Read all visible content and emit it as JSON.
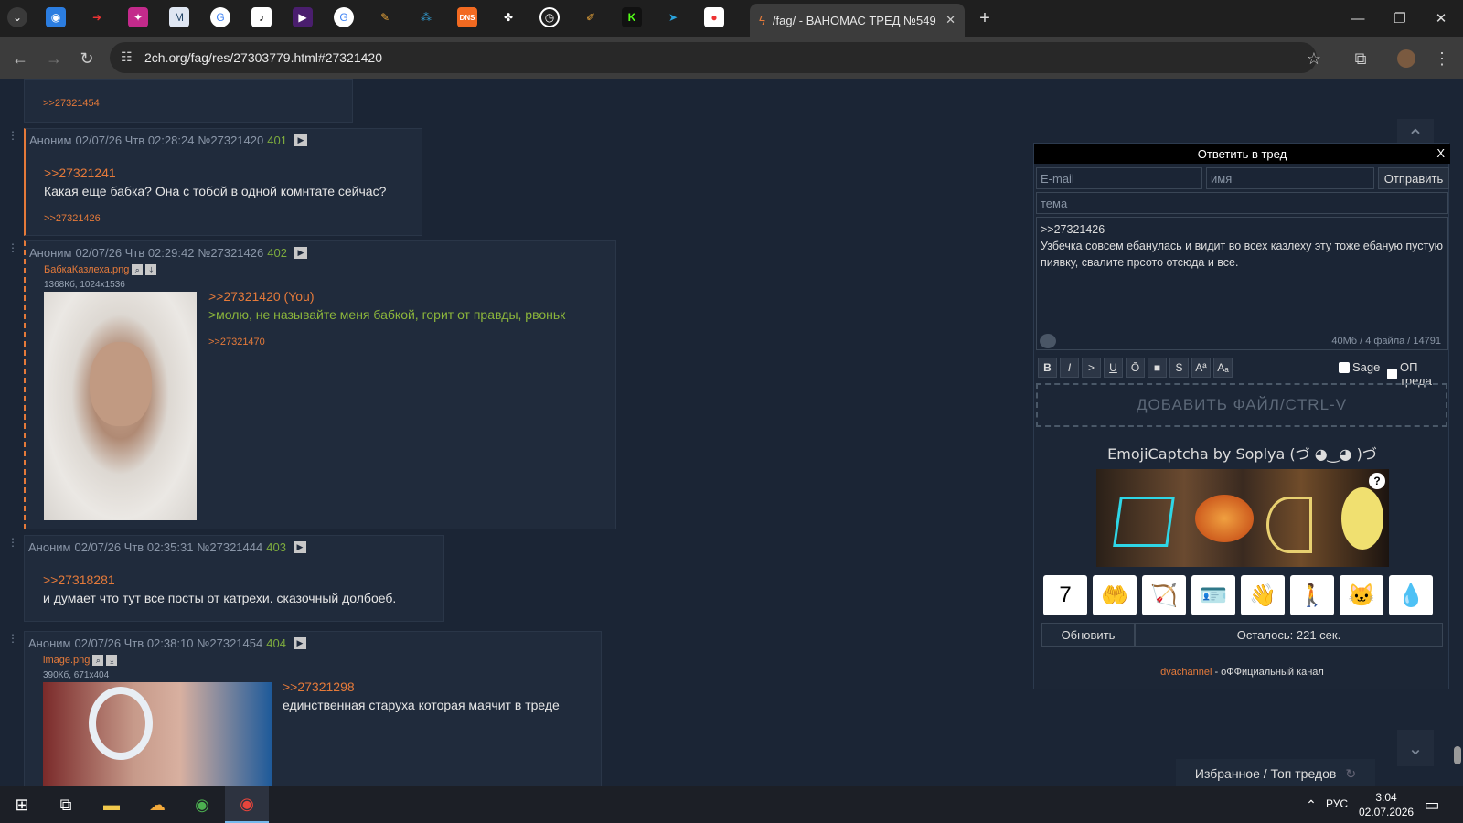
{
  "browser": {
    "tab_title": "/fag/ - ВАНОМАС ТРЕД №549",
    "url": "2ch.org/fag/res/27303779.html#27321420",
    "tab_icons": [
      "blue-globe-icon",
      "red-arrow-icon",
      "pink-grid-icon",
      "m-icon",
      "google-icon",
      "tiktok-icon",
      "purple-icon",
      "google-icon",
      "figure-icon",
      "apps-icon",
      "dns-icon",
      "fan-icon",
      "clock-icon",
      "pen-icon",
      "kick-icon",
      "telegram-icon",
      "red-dot-icon"
    ]
  },
  "posts": [
    {
      "reply_tail": ">>27321454"
    },
    {
      "name": "Аноним",
      "date": "02/07/26 Чтв 02:28:24",
      "id": "№27321420",
      "num": "401",
      "reply_to": ">>27321241",
      "text": "Какая еще бабка? Она с тобой в одной комнтате сейчас?",
      "replies": ">>27321426"
    },
    {
      "name": "Аноним",
      "date": "02/07/26 Чтв 02:29:42",
      "id": "№27321426",
      "num": "402",
      "file_name": "БабкаКазлеха.png",
      "file_info": "1368Кб, 1024x1536",
      "reply_to": ">>27321420 (You)",
      "greentext": ">молю, не называйте меня бабкой, горит от правды, рвоньк",
      "replies": ">>27321470"
    },
    {
      "name": "Аноним",
      "date": "02/07/26 Чтв 02:35:31",
      "id": "№27321444",
      "num": "403",
      "reply_to": ">>27318281",
      "text": "и думает что тут все посты от катрехи. сказочный долбоеб."
    },
    {
      "name": "Аноним",
      "date": "02/07/26 Чтв 02:38:10",
      "id": "№27321454",
      "num": "404",
      "file_name": "image.png",
      "file_info": "390Кб, 671x404",
      "reply_to": ">>27321298",
      "text": "единственная старуха которая маячит в треде"
    }
  ],
  "form": {
    "title": "Ответить в тред",
    "close": "X",
    "email_placeholder": "E-mail",
    "name_placeholder": "имя",
    "send_label": "Отправить",
    "subject_placeholder": "тема",
    "message": ">>27321426\nУзбечка совсем ебанулась и видит во всех казлеху эту тоже ебаную пустую пиявку, свалите прсото отсюда и все.",
    "limits": "40Мб / 4 файла / 14791",
    "format_buttons": [
      "B",
      "I",
      ">",
      "U",
      "Ō",
      "■",
      "S",
      "Aª",
      "Aₐ"
    ],
    "sage_label": "Sage",
    "op_label": "ОП треда",
    "dropzone": "ДОБАВИТЬ ФАЙЛ/CTRL-V",
    "captcha_title": "EmojiCaptcha by Soplya (づ ◕‿◕ )づ",
    "captcha_help": "?",
    "emoji_options": [
      "seven-icon",
      "open-hands-icon",
      "bow-icon",
      "id-card-icon",
      "waving-hand-icon",
      "person-walking-icon",
      "cat-face-icon",
      "drop-icon"
    ],
    "emoji_glyphs": [
      "7",
      "🤲",
      "🏹",
      "🪪",
      "👋",
      "🚶",
      "🐱",
      "💧"
    ],
    "refresh_label": "Обновить",
    "timer": "Осталось: 221 сек.",
    "channel_link": "dvachannel",
    "channel_text": " - оФФициальный канал"
  },
  "fav_bar": "Избранное / Топ тредов",
  "taskbar": {
    "lang": "РУС",
    "time": "3:04",
    "date": "02.07.2026"
  }
}
